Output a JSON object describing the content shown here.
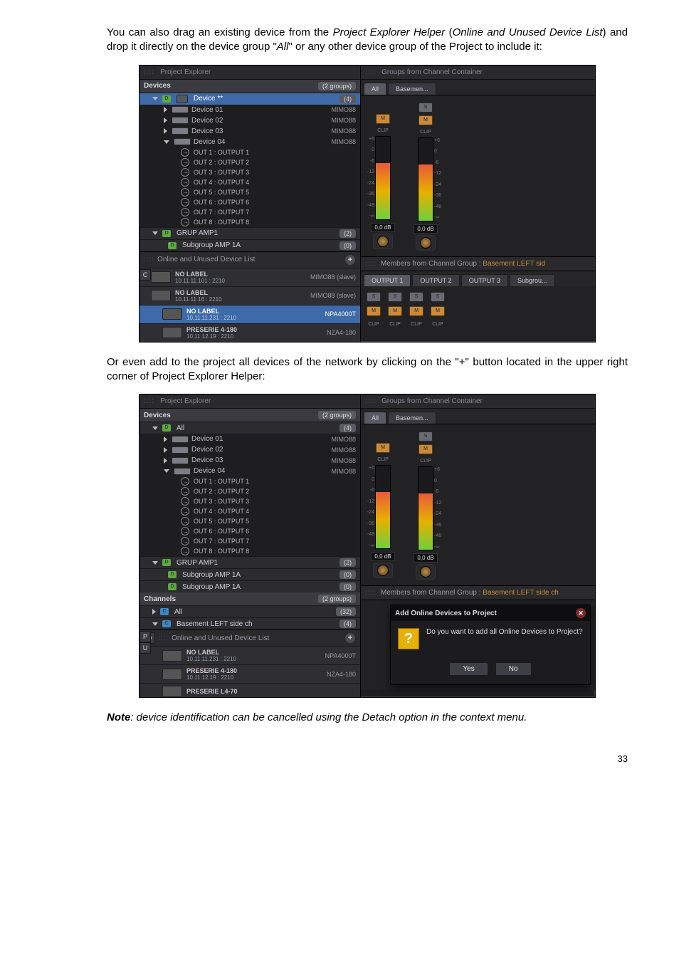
{
  "para1_a": "You can also drag an existing device from the ",
  "para1_b": "Project Explorer Helper",
  "para1_c": " (",
  "para1_d": "Online and Unused Device List",
  "para1_e": ") and drop it directly on the device group \"",
  "para1_f": "All",
  "para1_g": "\" or any other device group of the Project to include it:",
  "para2": "Or even add to the project all devices of the network by clicking on the \"+\" button located in the upper right corner of Project Explorer Helper:",
  "noteLead": "Note",
  "noteBody": ": device identification can be cancelled using the Detach option in the context menu.",
  "pageNumber": "33",
  "s1": {
    "leftTitle": "Project Explorer",
    "rightTitle": "Groups from Channel Container",
    "devicesHeader": "Devices",
    "devicesCount": "(2 groups)",
    "grpAll": "Device **",
    "grpAllBadge": "(4)",
    "devType": "MIMO88",
    "dev01": "Device 01",
    "dev02": "Device 02",
    "dev03": "Device 03",
    "dev04": "Device 04",
    "outs": [
      "OUT 1 : OUTPUT 1",
      "OUT 2 : OUTPUT 2",
      "OUT 3 : OUTPUT 3",
      "OUT 4 : OUTPUT 4",
      "OUT 5 : OUTPUT 5",
      "OUT 6 : OUTPUT 6",
      "OUT 7 : OUTPUT 7",
      "OUT 8 : OUTPUT 8"
    ],
    "grp1": "GRUP AMP1",
    "grp1Badge": "(2)",
    "sub1": "Subgroup AMP 1A",
    "sub1Badge": "(0)",
    "onlineTitle": "Online and Unused Device List",
    "plus": "+",
    "online": [
      {
        "name": "NO LABEL",
        "ip": "10.11.11.101 : 2210",
        "type": "MIMO88 (slave)"
      },
      {
        "name": "NO LABEL",
        "ip": "10.11.11.16 : 2210",
        "type": "MIMO88 (slave)"
      },
      {
        "name": "NO LABEL",
        "ip": "10.11.11.231 : 2210",
        "type": "NPA4000T"
      },
      {
        "name": "PRESERIE 4-180",
        "ip": "10.11.12.19 : 2210",
        "type": "NZA4-180"
      }
    ],
    "sideD": "D",
    "sideC": "C",
    "tabs": [
      "All",
      "Basemen..."
    ],
    "ticks": [
      "+6",
      "0",
      "-6",
      "-12",
      "-24",
      "-36",
      "-48",
      "-∞"
    ],
    "db": "0,0 dB",
    "solo": "S",
    "mute": "M",
    "clip": "CLIP",
    "membersTitle_a": "Members from Channel Group : ",
    "membersTitle_b": "Basement LEFT sid",
    "memberTabs": [
      "OUTPUT 1",
      "OUTPUT 2",
      "OUTPUT 3",
      "Subgrou..."
    ]
  },
  "s2": {
    "leftTitle": "Project Explorer",
    "rightTitle": "Groups from Channel Container",
    "devicesHeader": "Devices",
    "devicesCount": "(2 groups)",
    "grpAll": "All",
    "grpAllBadge": "(4)",
    "devType": "MIMO88",
    "dev01": "Device 01",
    "dev02": "Device 02",
    "dev03": "Device 03",
    "dev04": "Device 04",
    "outs": [
      "OUT 1 : OUTPUT 1",
      "OUT 2 : OUTPUT 2",
      "OUT 3 : OUTPUT 3",
      "OUT 4 : OUTPUT 4",
      "OUT 5 : OUTPUT 5",
      "OUT 6 : OUTPUT 6",
      "OUT 7 : OUTPUT 7",
      "OUT 8 : OUTPUT 8"
    ],
    "grp1": "GRUP AMP1",
    "grp1Badge": "(2)",
    "sub1": "Subgroup AMP 1A",
    "sub1Badge": "(0)",
    "sub2": "Subgroup AMP 1A",
    "sub2Badge": "(0)",
    "channelsHeader": "Channels",
    "channelsCount": "(2 groups)",
    "chAll": "All",
    "chAllBadge": "(32)",
    "chBase": "Basement LEFT side ch",
    "chBaseBadge": "(4)",
    "onlineTitle": "Online and Unused Device List",
    "plus": "+",
    "online": [
      {
        "name": "NO LABEL",
        "ip": "10.11.11.231 : 2210",
        "type": "NPA4000T"
      },
      {
        "name": "PRESERIE 4-180",
        "ip": "10.11.12.19 : 2210",
        "type": "NZA4-180"
      },
      {
        "name": "PRESERIE L4-70",
        "ip": "",
        "type": ""
      }
    ],
    "sideD": "D",
    "sideC": "C",
    "sideU": "U",
    "sideP": "P",
    "tabs": [
      "All",
      "Basemen..."
    ],
    "ticks": [
      "+6",
      "0",
      "-6",
      "-12",
      "-24",
      "-36",
      "-48",
      "-∞"
    ],
    "db": "0,0 dB",
    "solo": "S",
    "mute": "M",
    "clip": "CLIP",
    "membersTitle_a": "Members from Channel Group : ",
    "membersTitle_b": "Basement LEFT side ch",
    "dialogTitle": "Add Online Devices to Project",
    "dialogMsg": "Do you want to add all Online Devices to Project?",
    "dialogYes": "Yes",
    "dialogNo": "No",
    "dialogQ": "?"
  }
}
